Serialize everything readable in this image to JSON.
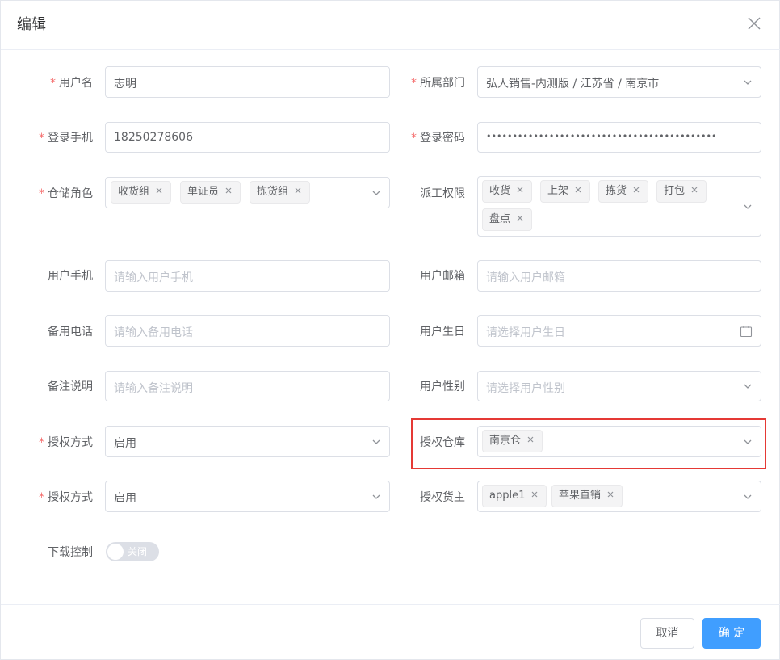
{
  "dialog": {
    "title": "编辑",
    "close_icon": "close-icon"
  },
  "form": {
    "username": {
      "label": "用户名",
      "required": true,
      "value": "志明"
    },
    "department": {
      "label": "所属部门",
      "required": true,
      "value": "弘人销售-内测版 / 江苏省 / 南京市"
    },
    "login_phone": {
      "label": "登录手机",
      "required": true,
      "value": "18250278606"
    },
    "login_password": {
      "label": "登录密码",
      "required": true,
      "value": "••••••••••••••••••••••••••••••••••••••••••••"
    },
    "warehouse_roles": {
      "label": "仓储角色",
      "required": true,
      "tags": [
        "收货组",
        "单证员",
        "拣货组"
      ]
    },
    "dispatch_permissions": {
      "label": "派工权限",
      "required": false,
      "tags": [
        "收货",
        "上架",
        "拣货",
        "打包",
        "盘点"
      ]
    },
    "user_phone": {
      "label": "用户手机",
      "required": false,
      "placeholder": "请输入用户手机"
    },
    "user_email": {
      "label": "用户邮箱",
      "required": false,
      "placeholder": "请输入用户邮箱"
    },
    "backup_phone": {
      "label": "备用电话",
      "required": false,
      "placeholder": "请输入备用电话"
    },
    "birthday": {
      "label": "用户生日",
      "required": false,
      "placeholder": "请选择用户生日"
    },
    "remark": {
      "label": "备注说明",
      "required": false,
      "placeholder": "请输入备注说明"
    },
    "gender": {
      "label": "用户性别",
      "required": false,
      "placeholder": "请选择用户性别"
    },
    "auth_mode_1": {
      "label": "授权方式",
      "required": true,
      "value": "启用"
    },
    "auth_warehouse": {
      "label": "授权仓库",
      "required": false,
      "tags": [
        "南京仓"
      ]
    },
    "auth_mode_2": {
      "label": "授权方式",
      "required": true,
      "value": "启用"
    },
    "auth_owner": {
      "label": "授权货主",
      "required": false,
      "tags": [
        "apple1",
        "苹果直销"
      ]
    },
    "download_control": {
      "label": "下载控制",
      "required": false,
      "switch_text": "关闭",
      "enabled": false
    }
  },
  "footer": {
    "cancel_label": "取消",
    "ok_label": "确 定"
  },
  "colors": {
    "primary": "#409eff",
    "required": "#f56c6c",
    "highlight": "#e53935"
  }
}
